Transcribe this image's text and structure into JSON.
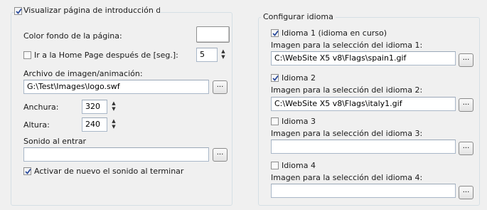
{
  "left": {
    "intro_label": "Visualizar página de introducción del sitio",
    "bg_color_label": "Color fondo de la página:",
    "home_label": "Ir a la Home Page después de  [seg.]:",
    "home_value": "5",
    "file_label": "Archivo de imagen/animación:",
    "file_value": "G:\\Test\\Images\\logo.swf",
    "width_label": "Anchura:",
    "width_value": "320",
    "height_label": "Altura:",
    "height_value": "240",
    "sound_label": "Sonido al entrar",
    "sound_value": "",
    "repeat_label": "Activar de nuevo el sonido al terminar"
  },
  "right": {
    "title": "Configurar idioma",
    "lang1_label": "Idioma 1 (idioma en curso)",
    "lang1_img_label": "Imagen para la selección del idioma 1:",
    "lang1_img_value": "C:\\WebSite X5 v8\\Flags\\spain1.gif",
    "lang2_label": "Idioma 2",
    "lang2_img_label": "Imagen para la selección del idioma 2:",
    "lang2_img_value": "C:\\WebSite X5 v8\\Flags\\italy1.gif",
    "lang3_label": "Idioma 3",
    "lang3_img_label": "Imagen para la selección del idioma 3:",
    "lang3_img_value": "",
    "lang4_label": "Idioma 4",
    "lang4_img_label": "Imagen para la selección del idioma 4:",
    "lang4_img_value": ""
  },
  "browse_label": "...",
  "spin_up": "▲",
  "spin_down": "▼"
}
